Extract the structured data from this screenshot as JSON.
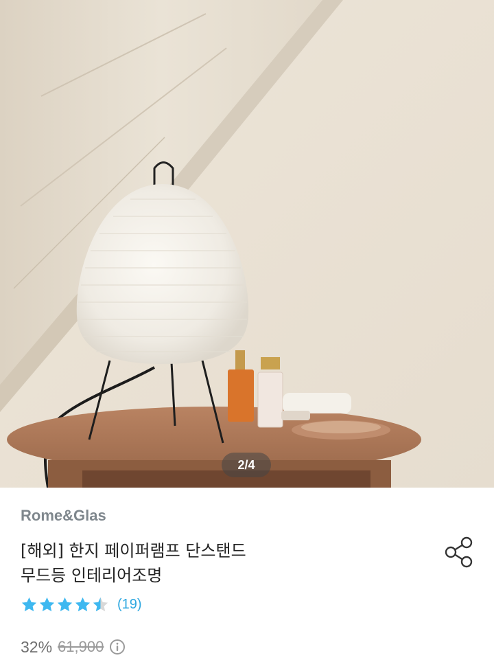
{
  "gallery": {
    "current": "2/4",
    "image_alt": "paper lamp on wooden table"
  },
  "product": {
    "brand": "Rome&Glas",
    "title_line1": "[해외] 한지 페이퍼램프 단스탠드",
    "title_line2": "무드등 인테리어조명",
    "rating": 4.5,
    "review_count": "(19)",
    "discount": "32%",
    "original_price": "61,900"
  },
  "icons": {
    "share": "share-icon",
    "info": "info-icon",
    "star": "star-icon"
  },
  "colors": {
    "brand_text": "#7f878d",
    "star": "#3eb8f0",
    "review_count": "#2fa8e0"
  }
}
